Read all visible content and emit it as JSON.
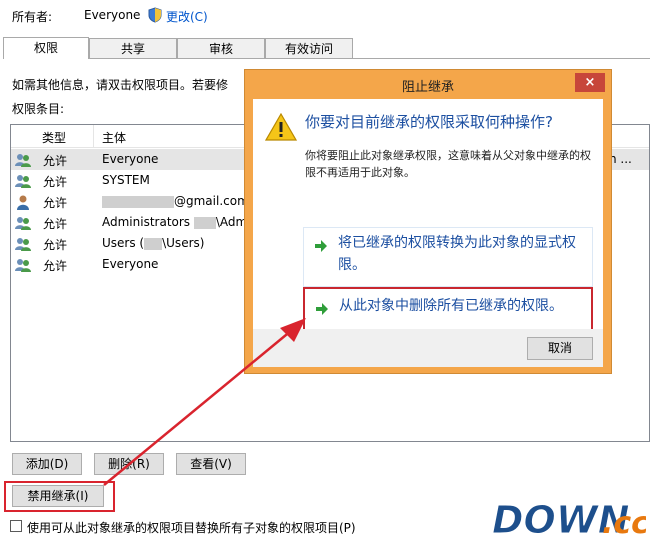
{
  "owner": {
    "label": "所有者:",
    "value": "Everyone",
    "change_link": "更改(C)"
  },
  "tabs": [
    {
      "label": "权限",
      "active": true
    },
    {
      "label": "共享",
      "active": false
    },
    {
      "label": "审核",
      "active": false
    },
    {
      "label": "有效访问",
      "active": false
    }
  ],
  "info_text": "如需其他信息，请双击权限项目。若要修",
  "entries_label": "权限条目:",
  "list": {
    "columns": [
      "类型",
      "主体"
    ],
    "rows": [
      {
        "type": "允许",
        "principal": "Everyone",
        "principal_suffix": "",
        "principal_tail": "",
        "tail": "n ...",
        "selected": true
      },
      {
        "type": "允许",
        "principal": "SYSTEM",
        "principal_suffix": "",
        "principal_tail": "",
        "tail": "",
        "selected": false
      },
      {
        "type": "允许",
        "principal": "",
        "principal_suffix": "@gmail.com",
        "principal_tail": "",
        "tail": "",
        "selected": false
      },
      {
        "type": "允许",
        "principal": "Administrators",
        "principal_suffix": "\\Admi",
        "principal_tail": "",
        "tail": "",
        "selected": false
      },
      {
        "type": "允许",
        "principal": "Users (",
        "principal_suffix": "\\Users)",
        "principal_tail": "",
        "tail": "",
        "selected": false
      },
      {
        "type": "允许",
        "principal": "Everyone",
        "principal_suffix": "",
        "principal_tail": "",
        "tail": "",
        "selected": false
      }
    ]
  },
  "buttons": {
    "add": "添加(D)",
    "remove": "删除(R)",
    "view": "查看(V)",
    "disable_inheritance": "禁用继承(I)"
  },
  "replace_checkbox_label": "使用可从此对象继承的权限项目替换所有子对象的权限项目(P)",
  "dialog": {
    "title": "阻止继承",
    "close": "×",
    "question": "你要对目前继承的权限采取何种操作?",
    "description": "你将要阻止此对象继承权限，这意味着从父对象中继承的权限不再适用于此对象。",
    "option_convert": "将已继承的权限转换为此对象的显式权限。",
    "option_remove": "从此对象中删除所有已继承的权限。",
    "cancel": "取消"
  },
  "watermark": {
    "main": "DOWN",
    "suffix": ".cc"
  },
  "colors": {
    "link_blue": "#1c4fa1",
    "highlight_red": "#d9242e",
    "dialog_frame": "#f4a64a"
  }
}
